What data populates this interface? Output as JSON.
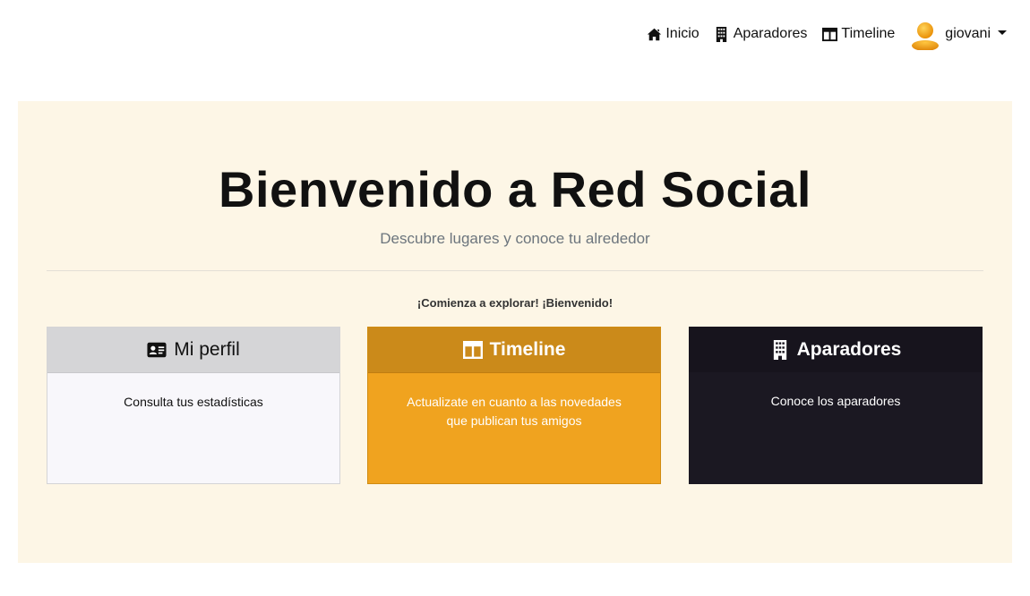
{
  "nav": {
    "items": [
      {
        "label": "Inicio",
        "icon": "home-icon"
      },
      {
        "label": "Aparadores",
        "icon": "building-icon"
      },
      {
        "label": "Timeline",
        "icon": "columns-icon"
      }
    ],
    "user": {
      "name": "giovani",
      "icon": "user-avatar-icon"
    }
  },
  "hero": {
    "title": "Bienvenido a Red Social",
    "subtitle": "Descubre lugares y conoce tu alrededor",
    "lead": "¡Comienza a explorar! ¡Bienvenido!"
  },
  "cards": [
    {
      "title": "Mi perfil",
      "text": "Consulta tus estadísticas",
      "icon": "id-card-icon"
    },
    {
      "title": "Timeline",
      "text": "Actualizate en cuanto a las novedades que publican tus amigos",
      "icon": "columns-icon"
    },
    {
      "title": "Aparadores",
      "text": "Conoce los aparadores",
      "icon": "building-icon"
    }
  ],
  "colors": {
    "hero_bg": "#fdf6e6",
    "profile_card": "#f8f7fb",
    "timeline_card": "#f0a31f",
    "aparadores_card": "#1b1822"
  }
}
